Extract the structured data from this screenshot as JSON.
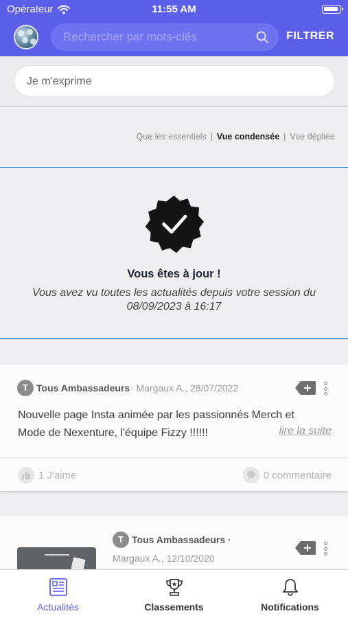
{
  "status": {
    "carrier": "Opérateur",
    "time": "11:55 AM"
  },
  "header": {
    "search_placeholder": "Rechercher par mots-clés",
    "filter_label": "FILTRER"
  },
  "compose": {
    "placeholder": "Je m'exprime"
  },
  "view_options": {
    "essentials": "Que les essentiels",
    "separator": "|",
    "condensed": "Vue condensée",
    "expanded": "Vue dépliée",
    "active": "condensed"
  },
  "uptodate": {
    "title": "Vous êtes à jour !",
    "text": "Vous avez vu toutes les actualités depuis votre session du 08/09/2023 à 16:17"
  },
  "posts": [
    {
      "author_initial": "T",
      "group": "Tous Ambassadeurs",
      "meta": "· Margaux A., 28/07/2022",
      "text": "Nouvelle page Insta animée par les passionnés Merch et Mode de Nexenture, l'équipe Fizzy !!!!!!",
      "read_more": "lire la suite",
      "likes": "1 J'aime",
      "comments": "0 commentaire"
    },
    {
      "author_initial": "T",
      "group": "Tous Ambassadeurs ·",
      "meta": "Margaux A., 12/10/2020"
    }
  ],
  "tabs": [
    {
      "label": "Actualités",
      "icon": "news-icon",
      "active": true
    },
    {
      "label": "Classements",
      "icon": "trophy-icon",
      "active": false
    },
    {
      "label": "Notifications",
      "icon": "bell-icon",
      "active": false
    }
  ],
  "colors": {
    "brand": "#5b5ee8",
    "accent_line": "#4a9ee0"
  }
}
